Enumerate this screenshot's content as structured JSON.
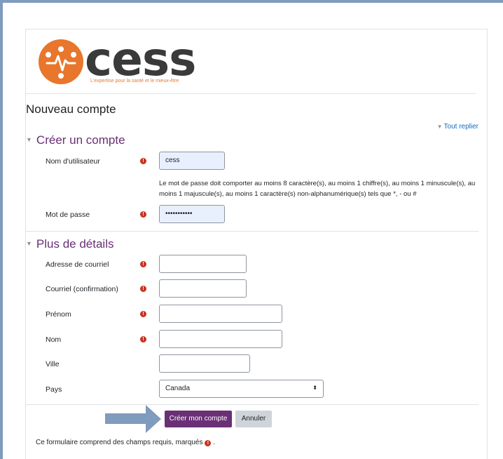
{
  "logo": {
    "wordmark": "cess",
    "tagline": "L'expertise pour la santé et le mieux-être",
    "brand_color": "#e8762c",
    "icon": "heartbeat-network-icon"
  },
  "page": {
    "title": "Nouveau compte",
    "collapse_all": "Tout replier"
  },
  "section_account": {
    "heading": "Créer un compte",
    "username_label": "Nom d'utilisateur",
    "username_value": "cess",
    "password_help": "Le mot de passe doit comporter au moins 8 caractère(s), au moins 1 chiffre(s), au moins 1 minuscule(s), au moins 1 majuscule(s), au moins 1 caractère(s) non-alphanumérique(s) tels que *, - ou #",
    "password_label": "Mot de passe",
    "password_value": "•••••••••••"
  },
  "section_details": {
    "heading": "Plus de détails",
    "email_label": "Adresse de courriel",
    "email_value": "",
    "email_confirm_label": "Courriel (confirmation)",
    "email_confirm_value": "",
    "firstname_label": "Prénom",
    "firstname_value": "",
    "lastname_label": "Nom",
    "lastname_value": "",
    "city_label": "Ville",
    "city_value": "",
    "country_label": "Pays",
    "country_value": "Canada"
  },
  "actions": {
    "submit_label": "Créer mon compte",
    "cancel_label": "Annuler"
  },
  "footer": {
    "required_note": "Ce formulaire comprend des champs requis, marqués",
    "required_suffix": "."
  },
  "colors": {
    "primary": "#6a2f75",
    "required": "#ca3120",
    "link": "#0f6cbf",
    "annotation_arrow": "#7f9bbd"
  }
}
